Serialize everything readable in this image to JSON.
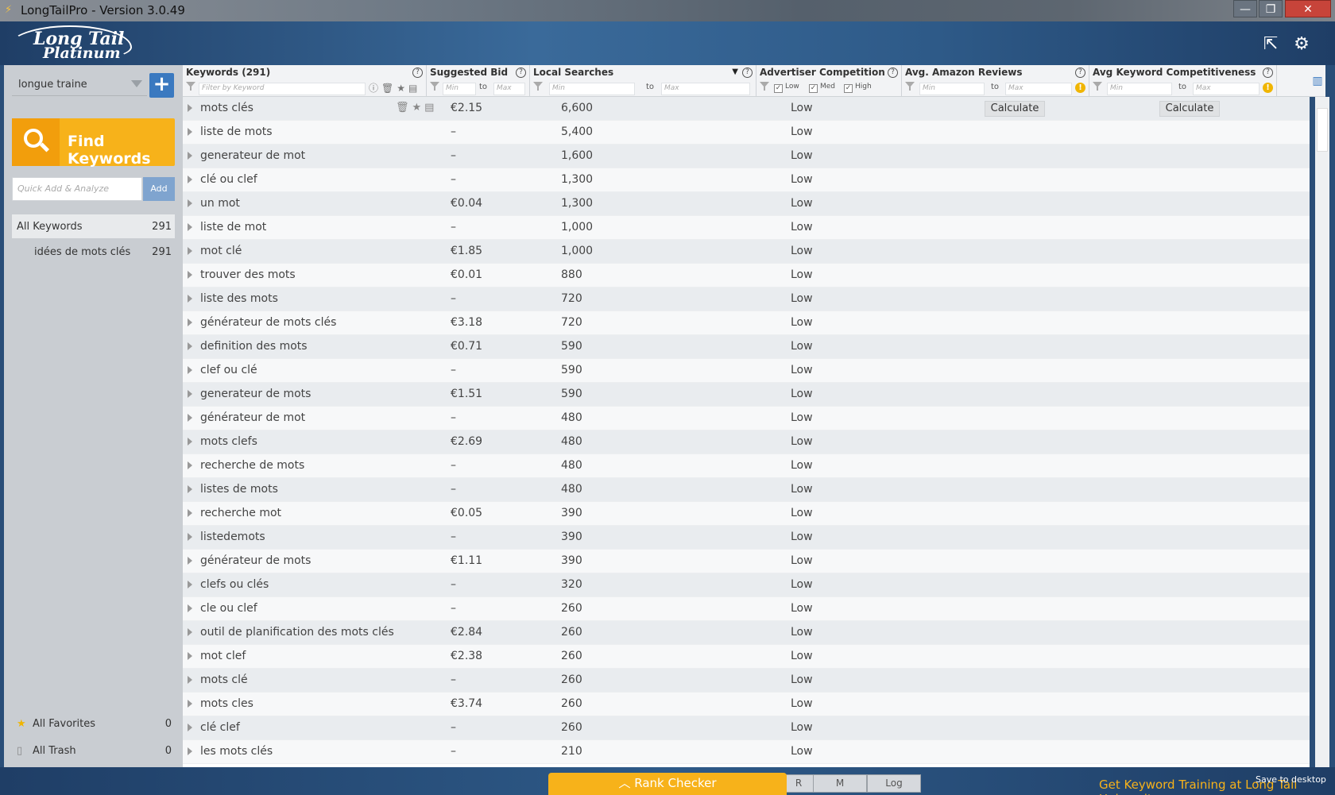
{
  "window": {
    "title": "LongTailPro - Version 3.0.49",
    "controls": {
      "minimize": "—",
      "maximize": "❐",
      "close": "✕"
    }
  },
  "logo": {
    "line1": "Long Tail",
    "line2": "Platinum"
  },
  "header_icons": {
    "export": "export-icon",
    "settings": "gear-icon"
  },
  "sidebar": {
    "project": "longue traine",
    "add_project": "+",
    "find_keywords": "Find Keywords",
    "quick_add_placeholder": "Quick Add & Analyze",
    "quick_add_button": "Add",
    "groups": [
      {
        "label": "All Keywords",
        "count": "291"
      },
      {
        "label": "idées de mots clés",
        "count": "291"
      }
    ],
    "favorites": {
      "label": "All Favorites",
      "count": "0"
    },
    "trash": {
      "label": "All Trash",
      "count": "0"
    }
  },
  "columns": {
    "keywords": {
      "title": "Keywords (291)",
      "filter_placeholder": "Filter by Keyword"
    },
    "bid": {
      "title": "Suggested Bid",
      "min": "Min",
      "to": "to",
      "max": "Max"
    },
    "searches": {
      "title": "Local Searches",
      "sort": "▼",
      "min": "Min",
      "to": "to",
      "max": "Max"
    },
    "competition": {
      "title": "Advertiser Competition",
      "low": "Low",
      "med": "Med",
      "high": "High"
    },
    "amazon": {
      "title": "Avg. Amazon Reviews",
      "min": "Min",
      "to": "to",
      "max": "Max"
    },
    "kc": {
      "title": "Avg Keyword Competitiveness",
      "min": "Min",
      "to": "to",
      "max": "Max"
    }
  },
  "calculate_label": "Calculate",
  "rows": [
    {
      "keyword": "mots clés",
      "bid": "€2.15",
      "searches": "6,600",
      "competition": "Low"
    },
    {
      "keyword": "liste de mots",
      "bid": "–",
      "searches": "5,400",
      "competition": "Low"
    },
    {
      "keyword": "generateur de mot",
      "bid": "–",
      "searches": "1,600",
      "competition": "Low"
    },
    {
      "keyword": "clé ou clef",
      "bid": "–",
      "searches": "1,300",
      "competition": "Low"
    },
    {
      "keyword": "un mot",
      "bid": "€0.04",
      "searches": "1,300",
      "competition": "Low"
    },
    {
      "keyword": "liste de mot",
      "bid": "–",
      "searches": "1,000",
      "competition": "Low"
    },
    {
      "keyword": "mot clé",
      "bid": "€1.85",
      "searches": "1,000",
      "competition": "Low"
    },
    {
      "keyword": "trouver des mots",
      "bid": "€0.01",
      "searches": "880",
      "competition": "Low"
    },
    {
      "keyword": "liste des mots",
      "bid": "–",
      "searches": "720",
      "competition": "Low"
    },
    {
      "keyword": "générateur de mots clés",
      "bid": "€3.18",
      "searches": "720",
      "competition": "Low"
    },
    {
      "keyword": "definition des mots",
      "bid": "€0.71",
      "searches": "590",
      "competition": "Low"
    },
    {
      "keyword": "clef ou clé",
      "bid": "–",
      "searches": "590",
      "competition": "Low"
    },
    {
      "keyword": "generateur de mots",
      "bid": "€1.51",
      "searches": "590",
      "competition": "Low"
    },
    {
      "keyword": "générateur de mot",
      "bid": "–",
      "searches": "480",
      "competition": "Low"
    },
    {
      "keyword": "mots clefs",
      "bid": "€2.69",
      "searches": "480",
      "competition": "Low"
    },
    {
      "keyword": "recherche de mots",
      "bid": "–",
      "searches": "480",
      "competition": "Low"
    },
    {
      "keyword": "listes de mots",
      "bid": "–",
      "searches": "480",
      "competition": "Low"
    },
    {
      "keyword": "recherche mot",
      "bid": "€0.05",
      "searches": "390",
      "competition": "Low"
    },
    {
      "keyword": "listedemots",
      "bid": "–",
      "searches": "390",
      "competition": "Low"
    },
    {
      "keyword": "générateur de mots",
      "bid": "€1.11",
      "searches": "390",
      "competition": "Low"
    },
    {
      "keyword": "clefs ou clés",
      "bid": "–",
      "searches": "320",
      "competition": "Low"
    },
    {
      "keyword": "cle ou clef",
      "bid": "–",
      "searches": "260",
      "competition": "Low"
    },
    {
      "keyword": "outil de planification des mots clés",
      "bid": "€2.84",
      "searches": "260",
      "competition": "Low"
    },
    {
      "keyword": "mot clef",
      "bid": "€2.38",
      "searches": "260",
      "competition": "Low"
    },
    {
      "keyword": "mots clé",
      "bid": "–",
      "searches": "260",
      "competition": "Low"
    },
    {
      "keyword": "mots cles",
      "bid": "€3.74",
      "searches": "260",
      "competition": "Low"
    },
    {
      "keyword": "clé clef",
      "bid": "–",
      "searches": "260",
      "competition": "Low"
    },
    {
      "keyword": "les mots clés",
      "bid": "–",
      "searches": "210",
      "competition": "Low"
    }
  ],
  "bottom": {
    "rank_checker": "Rank Checker",
    "tabs": [
      "R",
      "M",
      "Log"
    ],
    "training": "Get Keyword Training at Long Tail University",
    "save": "Save to desktop"
  },
  "colors": {
    "accent_orange": "#f7b21a",
    "accent_blue": "#3a79c0",
    "header_blue": "#2e5a88"
  }
}
